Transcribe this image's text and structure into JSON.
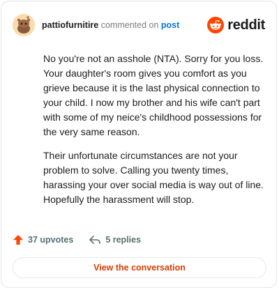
{
  "header": {
    "username": "pattiofurnitire",
    "verb": "commented on",
    "post_link": "post",
    "brand": "reddit"
  },
  "comment": {
    "paragraphs": [
      "No you're not an asshole (NTA). Sorry for you loss. Your daughter's room gives you comfort as you grieve because it is the last physical connection to your child. I now my brother and his wife can't part with some of my neice's childhood possessions for the very same reason.",
      "Their unfortunate circumstances are not your problem to solve. Calling you twenty times, harassing your over social media is way out of line. Hopefully the harassment will stop."
    ]
  },
  "actions": {
    "upvotes": "37 upvotes",
    "replies": "5 replies"
  },
  "footer": {
    "view_label": "View the conversation"
  },
  "colors": {
    "brand_orange": "#ff4500",
    "link_blue": "#0079d3",
    "cta_text": "#d93a00"
  },
  "icons": {
    "avatar": "snoo-avatar",
    "brand": "reddit-logo-icon",
    "upvote": "upvote-arrow-icon",
    "reply": "reply-arrow-icon"
  }
}
